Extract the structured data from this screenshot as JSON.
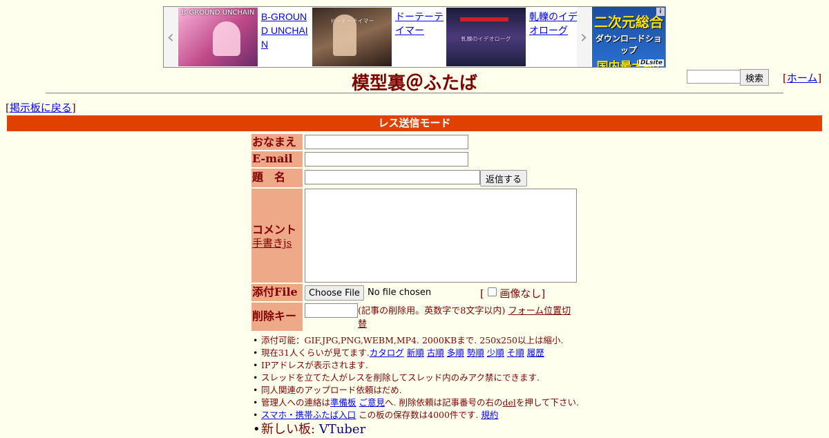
{
  "ad": {
    "items": [
      {
        "title": "B-GROUND UNCHAIN",
        "img_caption": "B-GROUND UNCHAIN"
      },
      {
        "title": "ドーテーテイマー",
        "img_caption": "ドーテーテイマー"
      },
      {
        "title": "軋轢のイデオローグ",
        "img_caption": "軋轢のイデオローグ"
      }
    ],
    "dlsite": {
      "line1": "二次元総合",
      "line2": "ダウンロードショップ",
      "line3": "国内最大級!",
      "brand": "DLsite"
    },
    "prev_icon": "chevron-left-icon",
    "next_icon": "chevron-right-icon"
  },
  "header": {
    "title": "模型裏＠ふたば",
    "search_button": "検索",
    "home_link": "ホーム",
    "back_link": "掲示板に戻る"
  },
  "mode_bar": "レス送信モード",
  "form": {
    "name_label": "おなまえ",
    "email_label": "E-mail",
    "subject_label": "題　名",
    "submit_button": "返信する",
    "comment_label": "コメント",
    "handwrite_link": "手書きjs",
    "file_label": "添付File",
    "file_button": "Choose File",
    "file_status": "No file chosen",
    "noimage_label": "画像なし",
    "delkey_label": "削除キー",
    "delkey_note": "(記事の削除用。英数字で8文字以内)",
    "form_toggle_link": "フォーム位置切替"
  },
  "notes": {
    "n1": "添付可能：GIF,JPG,PNG,WEBM,MP4. 2000KBまで. 250x250以上は縮小.",
    "n2_prefix": "現在31人くらいが見てます.",
    "n2_links": [
      "カタログ",
      "新順",
      "古順",
      "多順",
      "勢順",
      "少順",
      "そ順",
      "履歴"
    ],
    "n3": "IPアドレスが表示されます.",
    "n4": "スレッドを立てた人がレスを削除してスレッド内のみアク禁にできます.",
    "n5": "同人関連のアップロード依頼はだめ.",
    "n6_prefix": "管理人への連絡は",
    "n6_link1": "準備板",
    "n6_link2": "ご意見",
    "n6_mid": "へ. 削除依頼は記事番号の右の",
    "n6_link3": "del",
    "n6_suffix": "を押して下さい.",
    "n7_link": "スマホ・携帯ふたば入口",
    "n7_text": "この板の保存数は4000件です.",
    "n7_link2": "規約",
    "n8_prefix": "新しい板:",
    "n8_link": "VTuber"
  },
  "colors": {
    "background": "#ffffee",
    "text": "#800000",
    "label_bg": "#eeaa88",
    "mode_bar": "#e04000",
    "link": "#0000ee"
  }
}
